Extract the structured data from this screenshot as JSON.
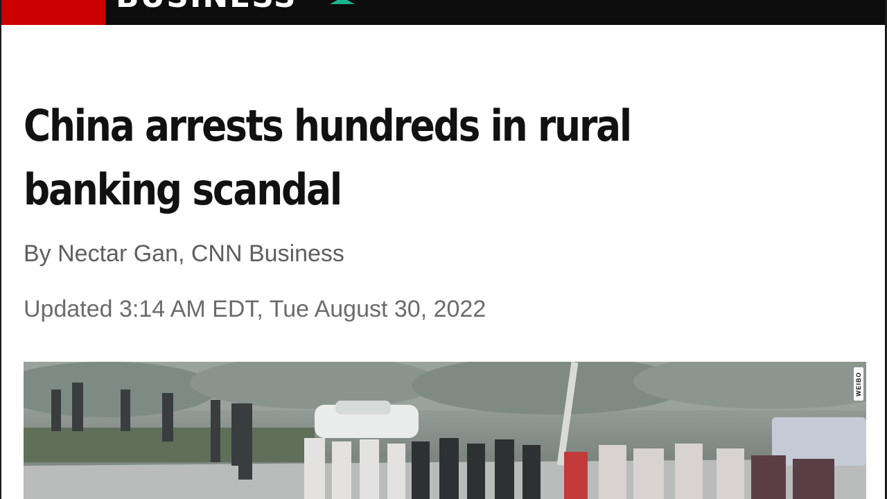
{
  "header": {
    "section_label": "BUSINESS",
    "brand_color": "#cc0000",
    "accent_color": "#19b38f"
  },
  "article": {
    "headline": "China arrests hundreds in rural banking scandal",
    "byline": "By Nectar Gan, CNN Business",
    "updated": "Updated 3:14 AM EDT, Tue August 30, 2022"
  },
  "media": {
    "watermark": "WEIBO"
  }
}
